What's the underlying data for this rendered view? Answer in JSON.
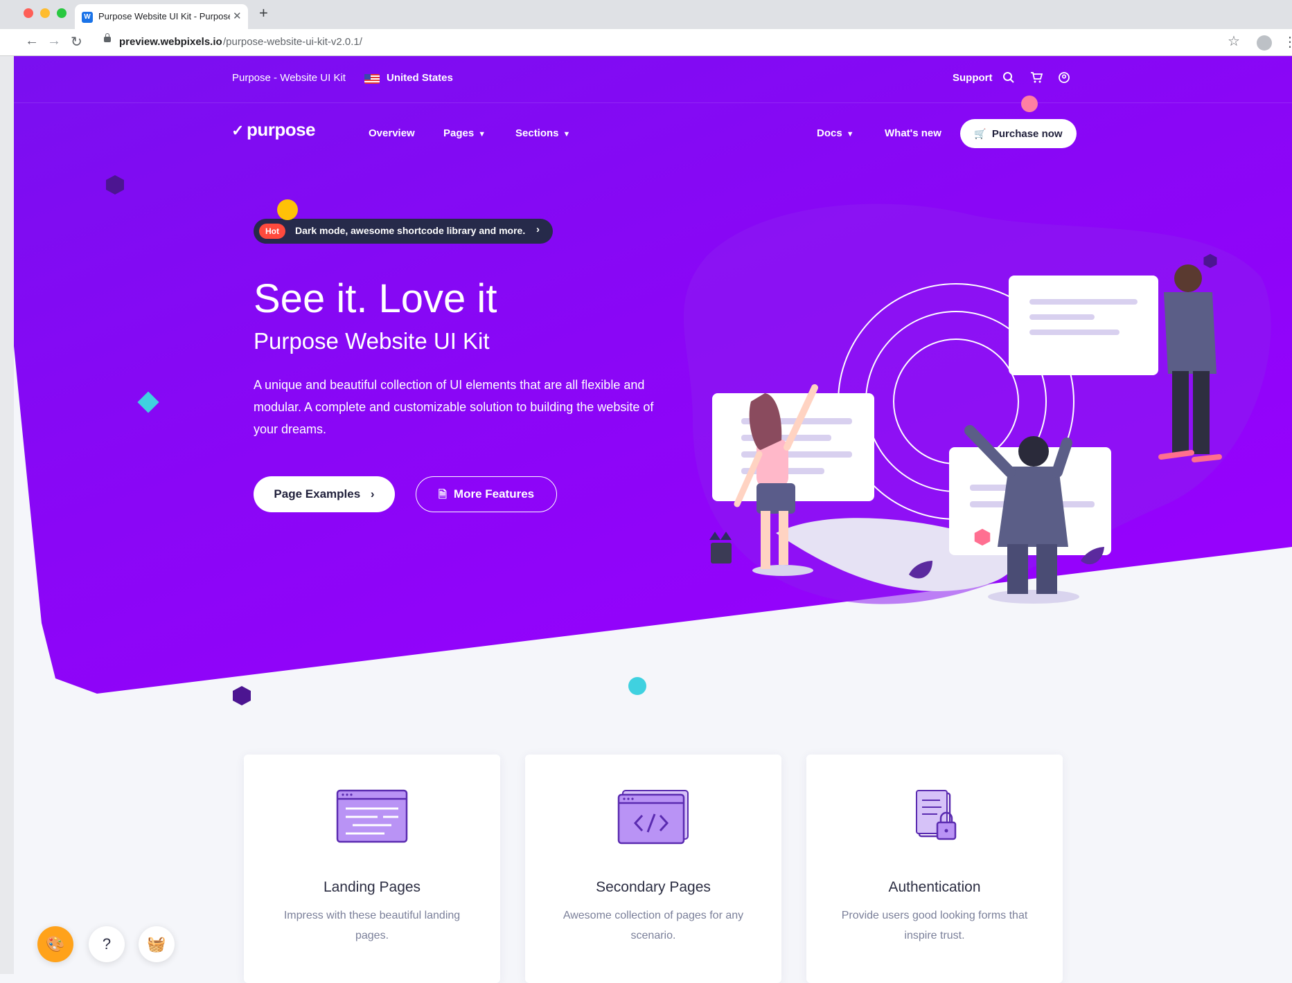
{
  "browser": {
    "tab_title": "Purpose Website UI Kit - Purpose",
    "favicon": "W",
    "url_host": "preview.webpixels.io",
    "url_path": "/purpose-website-ui-kit-v2.0.1/"
  },
  "topbar": {
    "brand": "Purpose - Website UI Kit",
    "country": "United States",
    "support": "Support"
  },
  "nav": {
    "logo": "purpose",
    "items": [
      "Overview",
      "Pages",
      "Sections",
      "Docs",
      "What's new"
    ],
    "purchase": "Purchase now"
  },
  "hero": {
    "badge": "Hot",
    "announcement": "Dark mode, awesome shortcode library and more.",
    "title": "See it. Love it",
    "subtitle": "Purpose Website UI Kit",
    "lead": "A unique and beautiful collection of UI elements that are all flexible and modular. A complete and customizable solution to building the website of your dreams.",
    "btn_primary": "Page Examples",
    "btn_secondary": "More Features"
  },
  "cards": [
    {
      "title": "Landing Pages",
      "desc": "Impress with these beautiful landing pages."
    },
    {
      "title": "Secondary Pages",
      "desc": "Awesome collection of pages for any scenario."
    },
    {
      "title": "Authentication",
      "desc": "Provide users good looking forms that inspire trust."
    }
  ],
  "colors": {
    "hero_start": "#7a0ff0",
    "hero_end": "#9b00ff",
    "hot_badge": "#ff4a3d",
    "fab_accent": "#ffa21a"
  }
}
